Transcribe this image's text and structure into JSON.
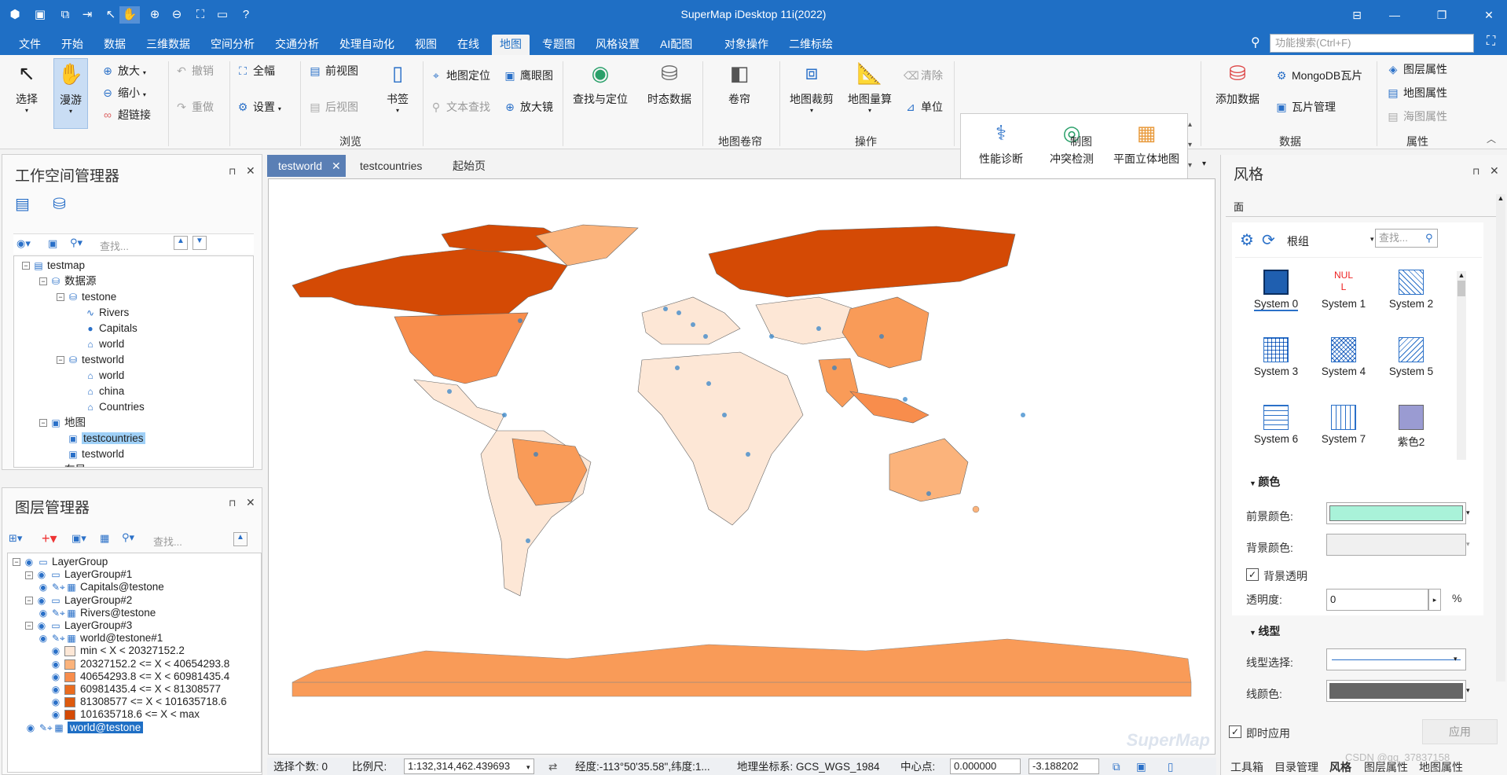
{
  "app": {
    "title": "SuperMap iDesktop 11i(2022)"
  },
  "menu": [
    "文件",
    "开始",
    "数据",
    "三维数据",
    "空间分析",
    "交通分析",
    "处理自动化",
    "视图",
    "在线",
    "地图",
    "专题图",
    "风格设置",
    "AI配图",
    "对象操作",
    "二维标绘"
  ],
  "active_menu": "地图",
  "search": {
    "placeholder": "功能搜索(Ctrl+F)"
  },
  "ribbon": {
    "select": "选择",
    "roam": "漫游",
    "zoom_in": "放大",
    "zoom_out": "缩小",
    "hyperlink": "超链接",
    "undo": "撤销",
    "redo": "重做",
    "full": "全幅",
    "settings": "设置",
    "prev_view": "前视图",
    "next_view": "后视图",
    "bookmark": "书签",
    "map_locate": "地图定位",
    "eagle_eye": "鹰眼图",
    "text_find": "文本查找",
    "magnifier": "放大镜",
    "find_locate": "查找与定位",
    "temporal": "时态数据",
    "browse_group": "浏览",
    "roller": "卷帘",
    "roller_group": "地图卷帘",
    "clip": "地图裁剪",
    "measure": "地图量算",
    "clear": "清除",
    "unit": "单位",
    "ops_group": "操作",
    "perf": "性能诊断",
    "conflict": "冲突检测",
    "plane3d": "平面立体地图",
    "mapping_group": "制图",
    "add_data": "添加数据",
    "mongo": "MongoDB瓦片",
    "tile_mgr": "瓦片管理",
    "data_group": "数据",
    "layer_prop": "图层属性",
    "map_prop": "地图属性",
    "chart_prop": "海图属性",
    "prop_group": "属性"
  },
  "workspace": {
    "title": "工作空间管理器",
    "search_placeholder": "查找...",
    "tree": [
      {
        "label": "testmap",
        "level": 0
      },
      {
        "label": "数据源",
        "level": 1
      },
      {
        "label": "testone",
        "level": 2
      },
      {
        "label": "Rivers",
        "level": 3
      },
      {
        "label": "Capitals",
        "level": 3
      },
      {
        "label": "world",
        "level": 3
      },
      {
        "label": "testworld",
        "level": 2
      },
      {
        "label": "world",
        "level": 3
      },
      {
        "label": "china",
        "level": 3
      },
      {
        "label": "Countries",
        "level": 3
      },
      {
        "label": "地图",
        "level": 1
      },
      {
        "label": "testcountries",
        "level": 2
      },
      {
        "label": "testworld",
        "level": 2
      },
      {
        "label": "布局",
        "level": 1
      }
    ]
  },
  "layers": {
    "title": "图层管理器",
    "search_placeholder": "查找...",
    "rows": [
      {
        "label": "LayerGroup"
      },
      {
        "label": "LayerGroup#1"
      },
      {
        "label": "Capitals@testone"
      },
      {
        "label": "LayerGroup#2"
      },
      {
        "label": "Rivers@testone"
      },
      {
        "label": "LayerGroup#3"
      },
      {
        "label": "world@testone#1"
      },
      {
        "label": "min < X < 20327152.2",
        "color": "#fde7d6"
      },
      {
        "label": "20327152.2 <= X < 40654293.8",
        "color": "#fbb37b"
      },
      {
        "label": "40654293.8 <= X < 60981435.4",
        "color": "#f88d4c"
      },
      {
        "label": "60981435.4 <= X < 81308577",
        "color": "#ea6c1f"
      },
      {
        "label": "81308577 <= X < 101635718.6",
        "color": "#dd5a0e"
      },
      {
        "label": "101635718.6 <= X < max",
        "color": "#d44a05"
      },
      {
        "label": "world@testone"
      }
    ]
  },
  "tabs": [
    "testworld",
    "testcountries",
    "起始页"
  ],
  "status": {
    "select_count": "选择个数: 0",
    "scale_label": "比例尺:",
    "scale_value": "1:132,314,462.439693",
    "coords": "经度:-113°50'35.58\",纬度:1...",
    "crs": "地理坐标系: GCS_WGS_1984",
    "center_label": "中心点:",
    "center_x": "0.000000",
    "center_y": "-3.188202"
  },
  "style": {
    "title": "风格",
    "tab": "面",
    "group": "根组",
    "search_placeholder": "查找...",
    "symbols": [
      "System 0",
      "System 1",
      "System 2",
      "System 3",
      "System 4",
      "System 5",
      "System 6",
      "System 7",
      "紫色2"
    ],
    "nul_text": "NUL\nL",
    "color_section": "颜色",
    "fg_label": "前景颜色:",
    "fg_color": "#a9f2d9",
    "bg_label": "背景颜色:",
    "bg_transparent": "背景透明",
    "transparency_label": "透明度:",
    "transparency_value": "0",
    "percent": "%",
    "line_section": "线型",
    "line_style_label": "线型选择:",
    "line_color_label": "线颜色:",
    "instant_apply": "即时应用",
    "apply": "应用"
  },
  "bottom_tabs": [
    "工具箱",
    "目录管理",
    "风格",
    "图层属性",
    "地图属性"
  ],
  "watermark": "CSDN @qq_37837158",
  "map_watermark": "SuperMap"
}
